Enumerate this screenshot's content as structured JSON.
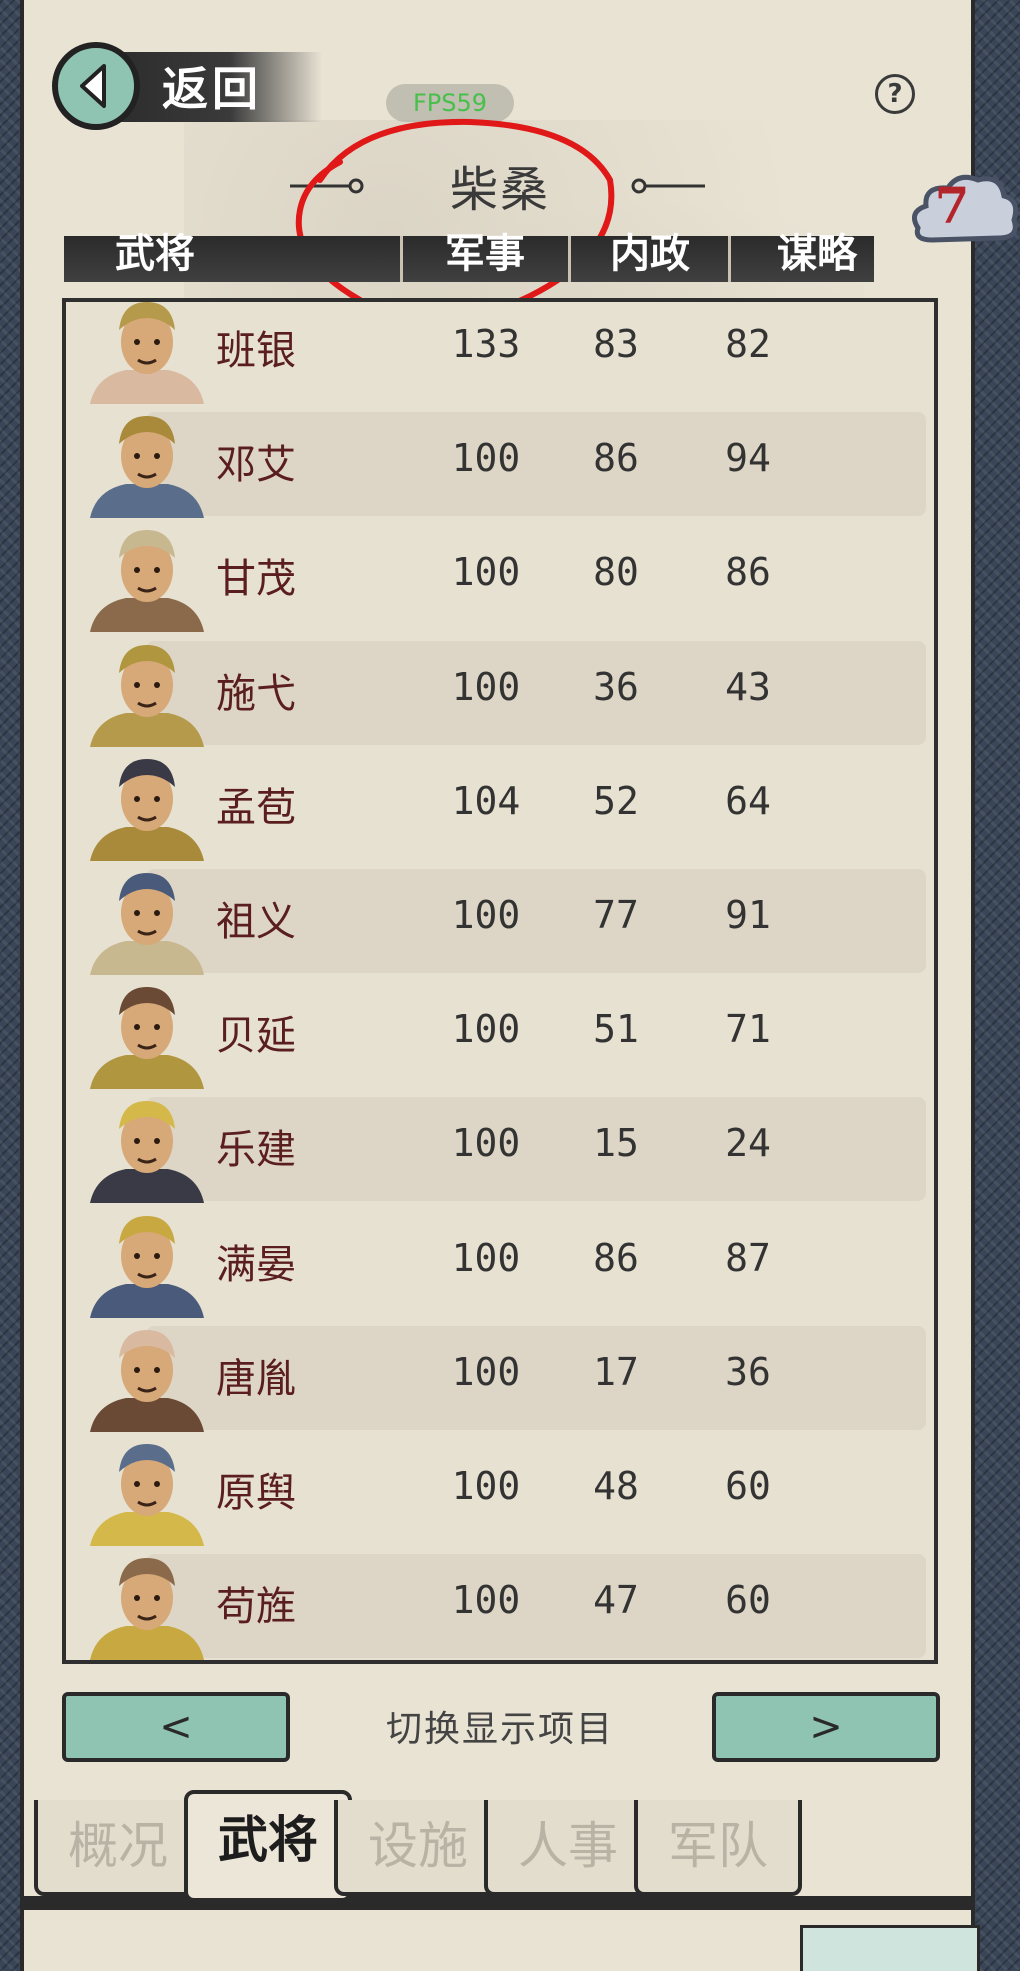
{
  "header": {
    "back_label": "返回",
    "fps": "FPS59",
    "city_title": "柴桑",
    "cloud_count": "7"
  },
  "columns": [
    "武将",
    "军事",
    "内政",
    "谋略"
  ],
  "officers": [
    {
      "name": "班银",
      "military": "133",
      "politics": "83",
      "strategy": "82"
    },
    {
      "name": "邓艾",
      "military": "100",
      "politics": "86",
      "strategy": "94"
    },
    {
      "name": "甘茂",
      "military": "100",
      "politics": "80",
      "strategy": "86"
    },
    {
      "name": "施弋",
      "military": "100",
      "politics": "36",
      "strategy": "43"
    },
    {
      "name": "孟苞",
      "military": "104",
      "politics": "52",
      "strategy": "64"
    },
    {
      "name": "祖义",
      "military": "100",
      "politics": "77",
      "strategy": "91"
    },
    {
      "name": "贝延",
      "military": "100",
      "politics": "51",
      "strategy": "71"
    },
    {
      "name": "乐建",
      "military": "100",
      "politics": "15",
      "strategy": "24"
    },
    {
      "name": "满晏",
      "military": "100",
      "politics": "86",
      "strategy": "87"
    },
    {
      "name": "唐胤",
      "military": "100",
      "politics": "17",
      "strategy": "36"
    },
    {
      "name": "原舆",
      "military": "100",
      "politics": "48",
      "strategy": "60"
    },
    {
      "name": "苟旌",
      "military": "100",
      "politics": "47",
      "strategy": "60"
    }
  ],
  "controls": {
    "prev_label": "<",
    "next_label": ">",
    "switch_label": "切换显示项目"
  },
  "tabs": [
    {
      "label": "概况",
      "active": false
    },
    {
      "label": "武将",
      "active": true
    },
    {
      "label": "设施",
      "active": false
    },
    {
      "label": "人事",
      "active": false
    },
    {
      "label": "军队",
      "active": false
    }
  ],
  "colors": {
    "accent_teal": "#8fc4b2",
    "name_red": "#5a1e1e",
    "badge_red": "#b4242b",
    "fps_green": "#46c04a"
  }
}
